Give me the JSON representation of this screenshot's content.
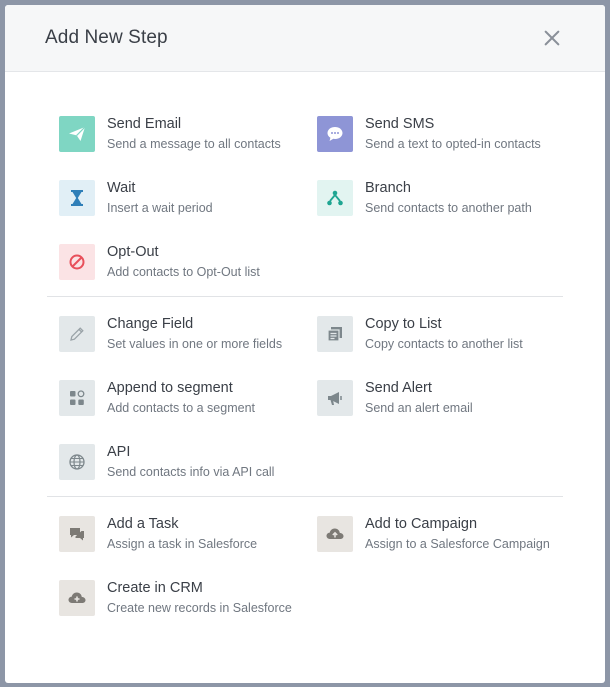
{
  "dialog": {
    "title": "Add New Step"
  },
  "groups": [
    {
      "options": [
        {
          "title": "Send Email",
          "desc": "Send a message to all contacts",
          "icon": "paper-plane-icon"
        },
        {
          "title": "Send SMS",
          "desc": "Send a text to opted-in contacts",
          "icon": "chat-bubble-icon"
        },
        {
          "title": "Wait",
          "desc": "Insert a wait period",
          "icon": "hourglass-icon"
        },
        {
          "title": "Branch",
          "desc": "Send contacts to another path",
          "icon": "branch-icon"
        },
        {
          "title": "Opt-Out",
          "desc": "Add contacts to Opt-Out list",
          "icon": "ban-icon"
        }
      ]
    },
    {
      "options": [
        {
          "title": "Change Field",
          "desc": "Set values in one or more fields",
          "icon": "pencil-icon"
        },
        {
          "title": "Copy to List",
          "desc": "Copy contacts to another list",
          "icon": "list-copy-icon"
        },
        {
          "title": "Append to segment",
          "desc": "Add contacts to a segment",
          "icon": "segment-icon"
        },
        {
          "title": "Send Alert",
          "desc": "Send an alert email",
          "icon": "megaphone-icon"
        },
        {
          "title": "API",
          "desc": "Send contacts info via API call",
          "icon": "globe-icon"
        }
      ]
    },
    {
      "options": [
        {
          "title": "Add a Task",
          "desc": "Assign a task in Salesforce",
          "icon": "task-chat-icon"
        },
        {
          "title": "Add to Campaign",
          "desc": "Assign to a Salesforce Campaign",
          "icon": "cloud-upload-icon"
        },
        {
          "title": "Create in CRM",
          "desc": "Create new records in Salesforce",
          "icon": "cloud-plus-icon"
        }
      ]
    }
  ],
  "colors": {
    "send_email_bg": "#7fd6c3",
    "send_sms_bg": "#8e95d6",
    "wait_accent": "#2f7fb8",
    "branch_accent": "#1fa592",
    "optout_accent": "#e8505b"
  }
}
